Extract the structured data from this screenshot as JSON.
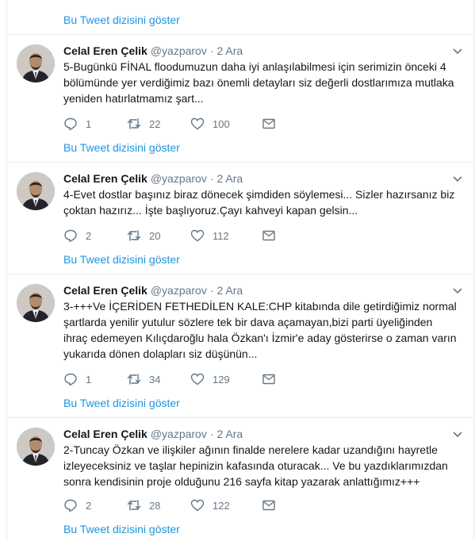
{
  "timeline": {
    "thread_link_label": "Bu Tweet dizisini göster",
    "tweets": [
      {
        "name": "Celal Eren Çelik",
        "handle": "@yazparov",
        "date": "2 Ara",
        "text": "5-Bugünkü FİNAL floodumuzun daha iyi anlaşılabilmesi için serimizin önceki 4 bölümünde yer verdiğimiz bazı önemli detayları siz değerli dostlarımıza mutlaka yeniden hatırlatmamız şart...",
        "replies": "1",
        "retweets": "22",
        "likes": "100"
      },
      {
        "name": "Celal Eren Çelik",
        "handle": "@yazparov",
        "date": "2 Ara",
        "text": "4-Evet dostlar başınız biraz dönecek şimdiden söylemesi... Sizler hazırsanız biz çoktan hazırız... İşte başlıyoruz.Çayı kahveyi kapan gelsin...",
        "replies": "2",
        "retweets": "20",
        "likes": "112"
      },
      {
        "name": "Celal Eren Çelik",
        "handle": "@yazparov",
        "date": "2 Ara",
        "text": "3-+++Ve İÇERİDEN FETHEDİLEN KALE:CHP kitabında dile getirdiğimiz normal şartlarda yenilir yutulur sözlere tek bir dava açamayan,bizi parti üyeliğinden ihraç edemeyen Kılıçdaroğlu hala Özkan'ı İzmir'e aday gösterirse o zaman varın yukarıda dönen dolapları siz düşünün...",
        "replies": "1",
        "retweets": "34",
        "likes": "129"
      },
      {
        "name": "Celal Eren Çelik",
        "handle": "@yazparov",
        "date": "2 Ara",
        "text": "2-Tuncay Özkan ve ilişkiler ağının finalde nerelere kadar uzandığını hayretle izleyeceksiniz ve taşlar hepinizin kafasında oturacak... Ve bu yazdıklarımızdan sonra kendisinin proje olduğunu 216 sayfa kitap yazarak anlattığımız+++",
        "replies": "2",
        "retweets": "28",
        "likes": "122"
      }
    ]
  },
  "icons": {
    "reply": "reply-icon",
    "retweet": "retweet-icon",
    "like": "heart-icon",
    "message": "envelope-icon",
    "caret": "chevron-down-icon"
  },
  "colors": {
    "link": "#1b95e0",
    "muted": "#657786",
    "border": "#e6ecf0"
  }
}
